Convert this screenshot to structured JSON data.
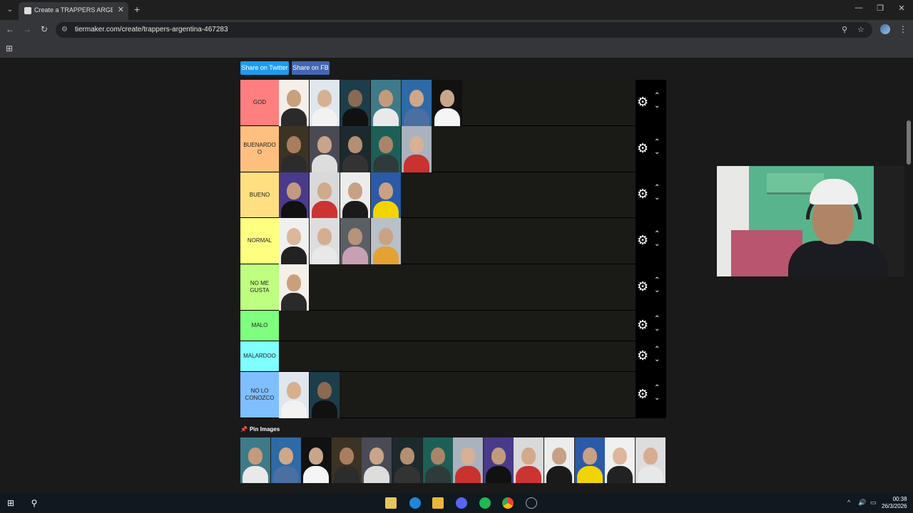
{
  "browser": {
    "tab_title": "Create a TRAPPERS ARGENTINA",
    "url": "tiermaker.com/create/trappers-argentina-467283"
  },
  "share": {
    "twitter": "Share on Twitter",
    "fb": "Share on FB"
  },
  "tiers": [
    {
      "label": "GOD",
      "color": "#ff7f7f",
      "count": 6
    },
    {
      "label": "BUENARDO O",
      "color": "#ffbf7f",
      "count": 5
    },
    {
      "label": "BUENO",
      "color": "#ffdf7f",
      "count": 4
    },
    {
      "label": "NORMAL",
      "color": "#ffff7f",
      "count": 4
    },
    {
      "label": "NO ME GUSTA",
      "color": "#bfff7f",
      "count": 1
    },
    {
      "label": "MALO",
      "color": "#7fff7f",
      "count": 0
    },
    {
      "label": "MALARDOO",
      "color": "#7fffff",
      "count": 0
    },
    {
      "label": "NO LO CONOZCO",
      "color": "#7fbfff",
      "count": 2
    }
  ],
  "pool": {
    "label": "Pin Images",
    "count": 14
  },
  "taskbar": {
    "time": "00:38",
    "date": "26/3/2026"
  }
}
